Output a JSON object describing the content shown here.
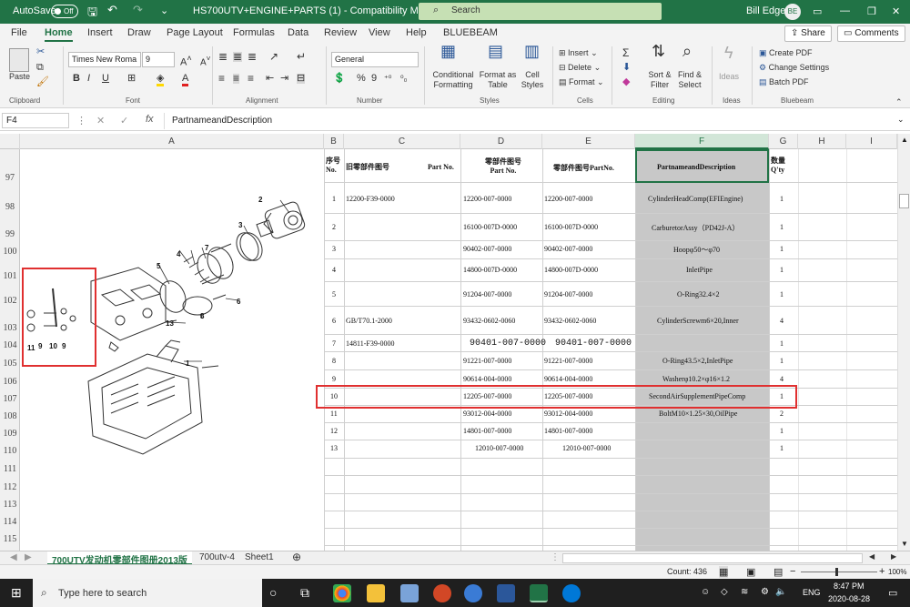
{
  "titlebar": {
    "autosave_label": "AutoSave",
    "autosave_state": "Off",
    "document_title": "HS700UTV+ENGINE+PARTS (1)  -  Compatibility Mode",
    "search_placeholder": "Search",
    "user_name": "Bill Edge",
    "user_initials": "BE"
  },
  "menu": {
    "items": [
      "File",
      "Home",
      "Insert",
      "Draw",
      "Page Layout",
      "Formulas",
      "Data",
      "Review",
      "View",
      "Help",
      "BLUEBEAM"
    ],
    "active": "Home",
    "share_label": "Share",
    "comments_label": "Comments"
  },
  "ribbon": {
    "paste_label": "Paste",
    "font_name": "Times New Roma",
    "font_size": "9",
    "number_format": "General",
    "conditional_label": "Conditional Formatting",
    "format_table_label": "Format as Table",
    "cell_styles_label": "Cell Styles",
    "insert_label": "Insert",
    "delete_label": "Delete",
    "format_label": "Format",
    "sort_label": "Sort & Filter",
    "find_label": "Find & Select",
    "ideas_label": "Ideas",
    "create_pdf": "Create PDF",
    "change_settings": "Change Settings",
    "batch_pdf": "Batch PDF",
    "groups": [
      "Clipboard",
      "Font",
      "Alignment",
      "Number",
      "Styles",
      "Cells",
      "Editing",
      "Ideas",
      "Bluebeam"
    ]
  },
  "formula_bar": {
    "name_box": "F4",
    "fx": "fx",
    "content": "PartnameandDescription"
  },
  "columns": [
    "A",
    "B",
    "C",
    "D",
    "E",
    "F",
    "G",
    "H",
    "I"
  ],
  "rows": [
    "97",
    "98",
    "99",
    "100",
    "101",
    "102",
    "103",
    "104",
    "105",
    "106",
    "107",
    "108",
    "109",
    "110",
    "111",
    "112",
    "113",
    "114",
    "115"
  ],
  "table_header": {
    "b": "序号 No.",
    "c": "旧零部件图号",
    "c2": "Part No.",
    "d": "零部件图号 Part No.",
    "e": "零部件图号PartNo.",
    "f": "PartnameandDescription",
    "g": "数量Q'ty"
  },
  "table_rows": [
    {
      "no": "1",
      "old": "12200-F39-0000",
      "d": "12200-007-0000",
      "e": "12200-007-0000",
      "desc": "CylinderHeadComp(EFIEngine)",
      "qty": "1"
    },
    {
      "no": "2",
      "old": "",
      "d": "16100-007D-0000",
      "e": "16100-007D-0000",
      "desc": "CarburetorAssy（PD42J-A）",
      "qty": "1"
    },
    {
      "no": "3",
      "old": "",
      "d": "90402-007-0000",
      "e": "90402-007-0000",
      "desc": "Hoopφ50～φ70",
      "qty": "1"
    },
    {
      "no": "4",
      "old": "",
      "d": "14800-007D-0000",
      "e": "14800-007D-0000",
      "desc": "InletPipe",
      "qty": "1"
    },
    {
      "no": "5",
      "old": "",
      "d": "91204-007-0000",
      "e": "91204-007-0000",
      "desc": "O-Ring32.4×2",
      "qty": "1"
    },
    {
      "no": "6",
      "old": "GB/T70.1-2000",
      "d": "93432-0602-0060",
      "e": "93432-0602-0060",
      "desc": "CylinderScrewm6×20,Inner",
      "qty": "4"
    },
    {
      "no": "7",
      "old": "14811-F39-0000",
      "d": "90401-007-0000",
      "e": "90401-007-0000",
      "desc": "",
      "qty": "1"
    },
    {
      "no": "8",
      "old": "",
      "d": "91221-007-0000",
      "e": "91221-007-0000",
      "desc": "O-Ring43.5×2,InletPipe",
      "qty": "1"
    },
    {
      "no": "9",
      "old": "",
      "d": "90614-004-0000",
      "e": "90614-004-0000",
      "desc": "Washerφ10.2×φ16×1.2",
      "qty": "4"
    },
    {
      "no": "10",
      "old": "",
      "d": "12205-007-0000",
      "e": "12205-007-0000",
      "desc": "SecondAirSupplementPipeComp",
      "qty": "1"
    },
    {
      "no": "11",
      "old": "",
      "d": "93012-004-0000",
      "e": "93012-004-0000",
      "desc": "BoltM10×1.25×30,OilPipe",
      "qty": "2"
    },
    {
      "no": "12",
      "old": "",
      "d": "14801-007-0000",
      "e": "14801-007-0000",
      "desc": "",
      "qty": "1"
    },
    {
      "no": "13",
      "old": "",
      "d": "12010-007-0000",
      "e": "12010-007-0000",
      "desc": "",
      "qty": "1"
    }
  ],
  "drawing_labels": [
    "1",
    "2",
    "3",
    "4",
    "5",
    "6",
    "7",
    "8",
    "9",
    "10",
    "11",
    "9",
    "13"
  ],
  "tabs": [
    "700UTV发动机零部件图册2013版",
    "700utv-4",
    "Sheet1"
  ],
  "active_tab": "700UTV发动机零部件图册2013版",
  "status": {
    "count": "Count: 436",
    "zoom": "100%"
  },
  "taskbar": {
    "search_placeholder": "Type here to search",
    "lang": "ENG",
    "time": "8:47 PM",
    "date": "2020-08-28"
  },
  "colors": {
    "excel_green": "#217346",
    "highlight_red": "#e03030",
    "column_f_fill": "#c8c8c8"
  }
}
